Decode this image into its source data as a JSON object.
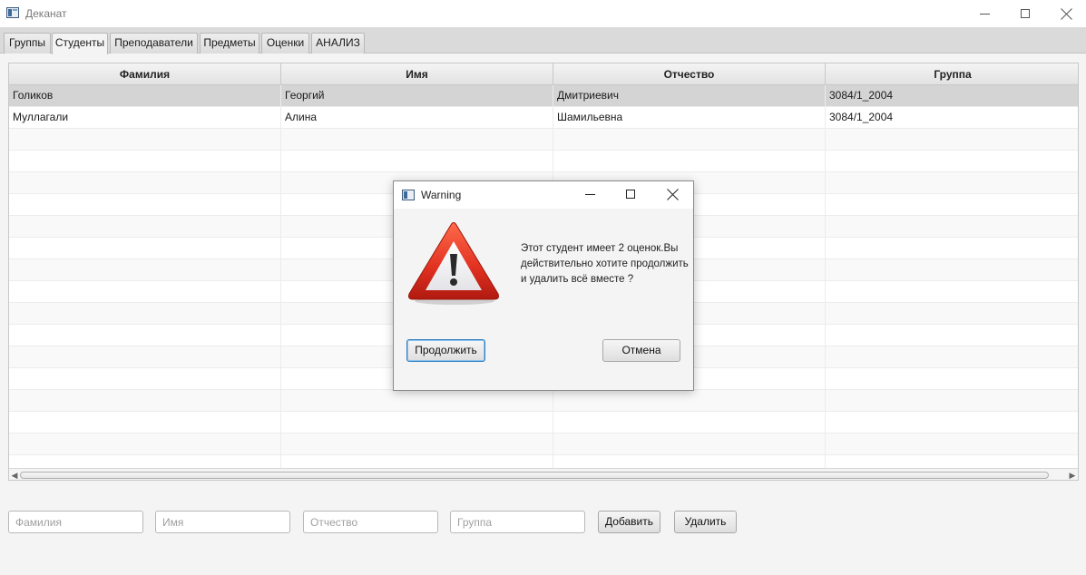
{
  "window": {
    "title": "Деканат"
  },
  "tabs": [
    {
      "label": "Группы"
    },
    {
      "label": "Студенты"
    },
    {
      "label": "Преподаватели"
    },
    {
      "label": "Предметы"
    },
    {
      "label": "Оценки"
    },
    {
      "label": "АНАЛИЗ"
    }
  ],
  "selected_tab": "Студенты",
  "table": {
    "headers": [
      "Фамилия",
      "Имя",
      "Отчество",
      "Группа"
    ],
    "rows": [
      {
        "c1": "Голиков",
        "c2": "Георгий",
        "c3": "Дмитриевич",
        "c4": "3084/1_2004"
      },
      {
        "c1": "Муллагали",
        "c2": "Алина",
        "c3": "Шамильевна",
        "c4": "3084/1_2004"
      }
    ]
  },
  "form": {
    "lastname_placeholder": "Фамилия",
    "firstname_placeholder": "Имя",
    "patronymic_placeholder": "Отчество",
    "group_placeholder": "Группа",
    "add_label": "Добавить",
    "delete_label": "Удалить"
  },
  "dialog": {
    "title": "Warning",
    "message": "Этот студент имеет 2 оценок.Вы действительно хотите продолжить и удалить всё вместе ?",
    "continue_label": "Продолжить",
    "cancel_label": "Отмена",
    "icon": "warning-icon"
  },
  "colors": {
    "selected_row": "#d4d4d4",
    "warning_red": "#e03020",
    "default_button_border": "#2f7fc4"
  }
}
